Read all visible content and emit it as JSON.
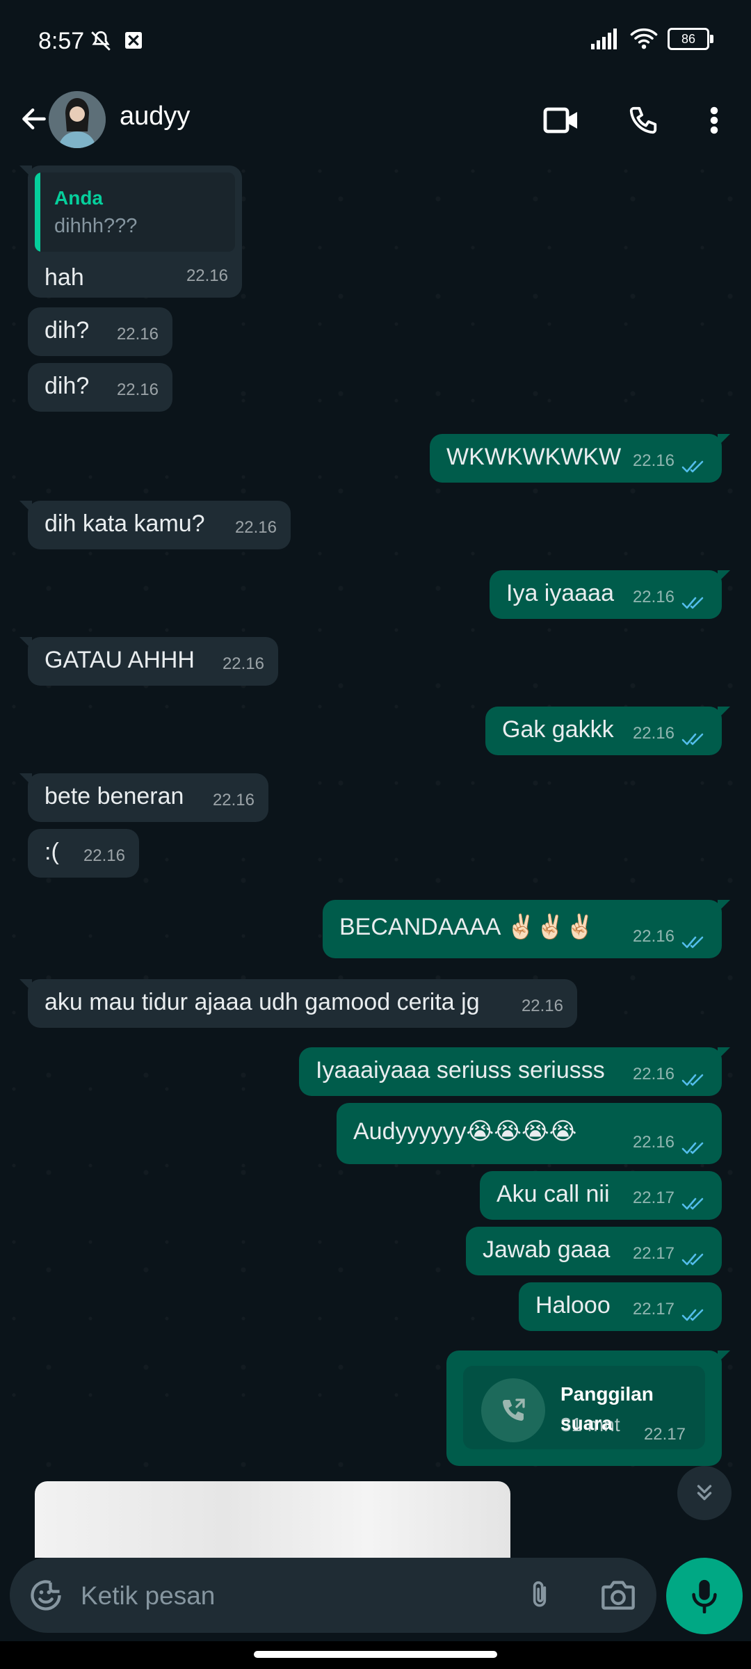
{
  "status": {
    "time": "8:57",
    "battery": "86"
  },
  "header": {
    "contact_name": "audyy"
  },
  "messages": [
    {
      "dir": "in",
      "quote_author": "Anda",
      "quote_text": "dihhh???",
      "text": "hah",
      "time": "22.16"
    },
    {
      "dir": "in",
      "text": "dih?",
      "time": "22.16"
    },
    {
      "dir": "in",
      "text": "dih?",
      "time": "22.16"
    },
    {
      "dir": "out",
      "text": "WKWKWKWKW",
      "time": "22.16"
    },
    {
      "dir": "in",
      "text": "dih kata kamu?",
      "time": "22.16"
    },
    {
      "dir": "out",
      "text": "Iya iyaaaa",
      "time": "22.16"
    },
    {
      "dir": "in",
      "text": "GATAU AHHH",
      "time": "22.16"
    },
    {
      "dir": "out",
      "text": "Gak gakkk",
      "time": "22.16"
    },
    {
      "dir": "in",
      "text": "bete beneran",
      "time": "22.16"
    },
    {
      "dir": "in",
      "text": ":(",
      "time": "22.16"
    },
    {
      "dir": "out",
      "text": "BECANDAAAA ✌🏻✌🏻✌🏻",
      "time": "22.16"
    },
    {
      "dir": "in",
      "text": "aku mau tidur ajaaa udh gamood cerita jg",
      "time": "22.16"
    },
    {
      "dir": "out",
      "text": "Iyaaaiyaaa seriuss seriusss",
      "time": "22.16"
    },
    {
      "dir": "out",
      "text": "Audyyyyyy😭😭😭😭",
      "time": "22.16"
    },
    {
      "dir": "out",
      "text": "Aku call nii",
      "time": "22.17"
    },
    {
      "dir": "out",
      "text": "Jawab gaaa",
      "time": "22.17"
    },
    {
      "dir": "out",
      "text": "Halooo",
      "time": "22.17"
    }
  ],
  "call": {
    "title": "Panggilan suara",
    "duration": "31 mnt",
    "time": "22.17"
  },
  "composer": {
    "placeholder": "Ketik pesan"
  },
  "colors": {
    "incoming": "#1f2c34",
    "outgoing": "#005c4b",
    "accent": "#00a884",
    "read_tick": "#53bdeb"
  }
}
